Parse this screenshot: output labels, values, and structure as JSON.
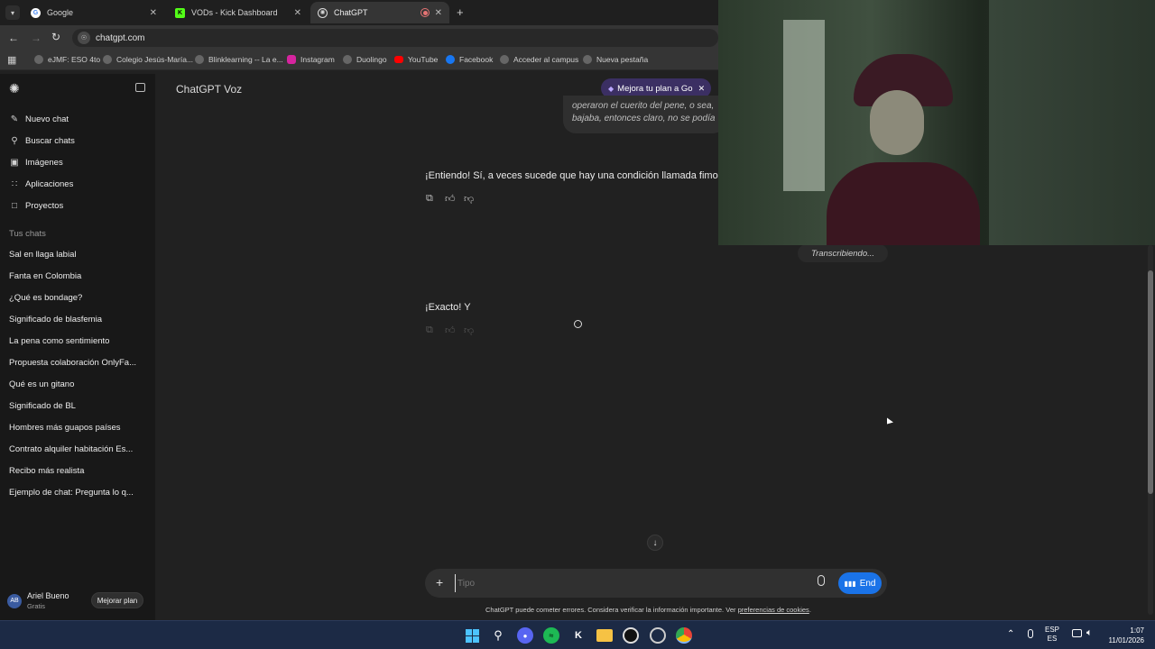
{
  "browser": {
    "tabs": [
      {
        "title": "Google",
        "icon": "google-icon"
      },
      {
        "title": "VODs - Kick Dashboard",
        "icon": "kick-icon"
      },
      {
        "title": "ChatGPT",
        "icon": "chatgpt-icon",
        "active": true
      }
    ],
    "new_tab_symbol": "+",
    "url": "chatgpt.com",
    "bookmarks": [
      "eJMF: ESO 4to",
      "Colegio Jesús-María...",
      "Blinklearning -- La e...",
      "Instagram",
      "Duolingo",
      "YouTube",
      "Facebook",
      "Acceder al campus",
      "Nueva pestaña"
    ]
  },
  "sidebar": {
    "nav": [
      {
        "label": "Nuevo chat",
        "icon": "edit-icon"
      },
      {
        "label": "Buscar chats",
        "icon": "search-icon"
      },
      {
        "label": "Imágenes",
        "icon": "image-icon"
      },
      {
        "label": "Aplicaciones",
        "icon": "apps-icon"
      },
      {
        "label": "Proyectos",
        "icon": "folder-icon"
      }
    ],
    "section_title": "Tus chats",
    "chats": [
      "Sal en llaga labial",
      "Fanta en Colombia",
      "¿Qué es bondage?",
      "Significado de blasfemia",
      "La pena como sentimiento",
      "Propuesta colaboración OnlyFa...",
      "Qué es un gitano",
      "Significado de BL",
      "Hombres más guapos países",
      "Contrato alquiler habitación Es...",
      "Recibo más realista",
      "Ejemplo de chat: Pregunta lo q..."
    ],
    "user": {
      "initials": "AB",
      "name": "Ariel Bueno",
      "plan": "Gratis"
    },
    "upgrade_label": "Mejorar plan"
  },
  "main": {
    "title": "ChatGPT Voz",
    "upgrade_pill": "Mejora tu plan a Go",
    "user_bubble_line1": "operaron el cuerito del pene, o sea,",
    "user_bubble_line2": "bajaba, entonces claro, no se podía",
    "assistant_msg1": "¡Entiendo! Sí, a veces sucede que hay una condición llamada fimosis, y",
    "assistant_msg2": "¡Exacto! Y",
    "transcribing": "Transcribiendo...",
    "input_placeholder": "Tipo",
    "end_label": "End",
    "disclaimer": "ChatGPT puede cometer errores. Considera verificar la información importante. Ver",
    "disclaimer_link": "preferencias de cookies",
    "disclaimer_end": "."
  },
  "taskbar": {
    "lang_top": "ESP",
    "lang_bottom": "ES",
    "time": "1:07",
    "date": "11/01/2026"
  },
  "colors": {
    "accent_blue": "#1a73e8",
    "sidebar": "#181818",
    "main": "#212121",
    "pill": "#3b2f63"
  }
}
